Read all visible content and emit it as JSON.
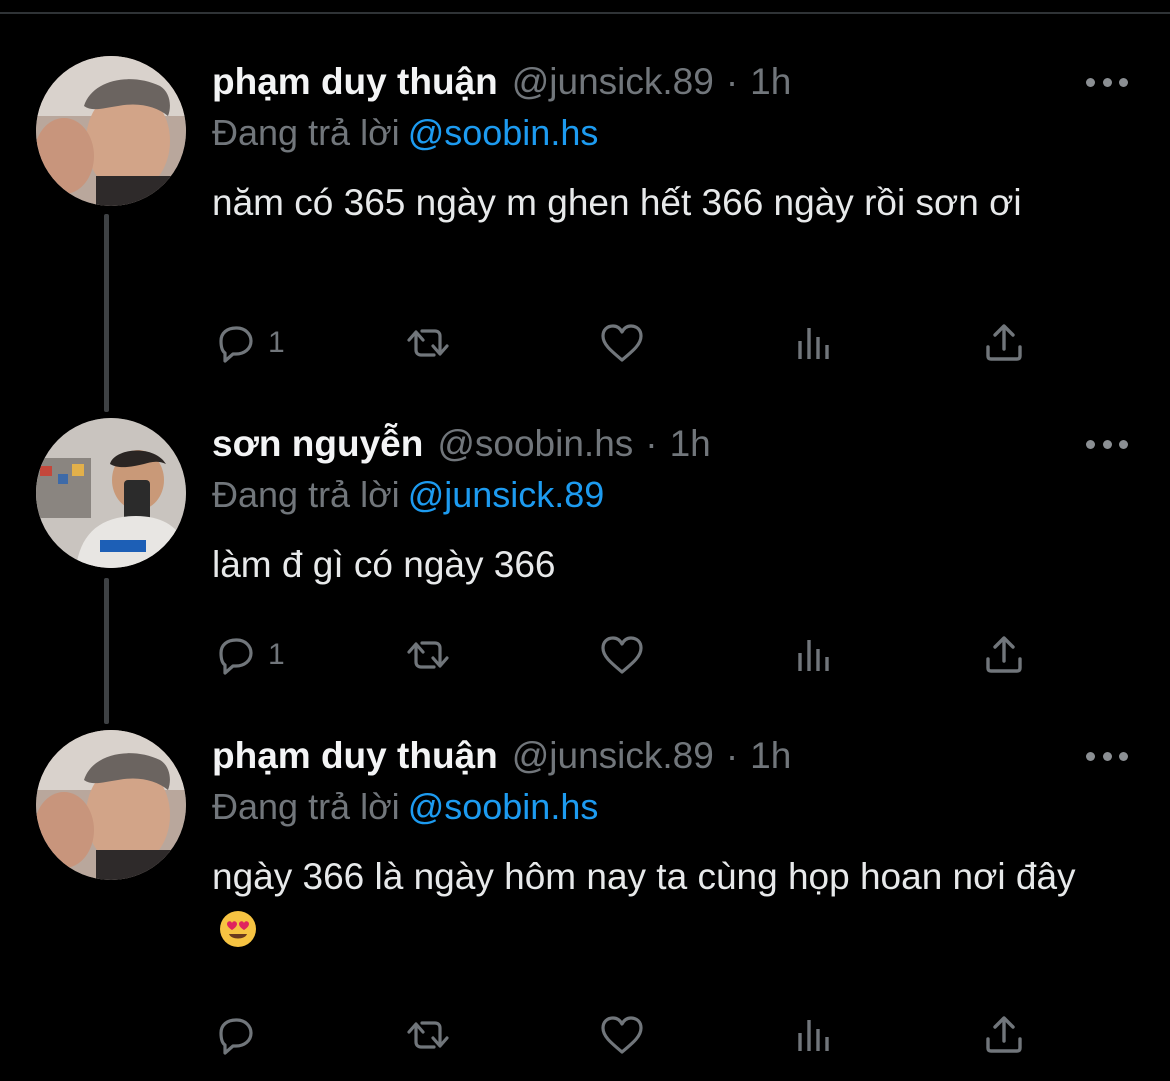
{
  "tweets": [
    {
      "name": "phạm duy thuận",
      "handle": "@junsick.89",
      "separator": "·",
      "time": "1h",
      "reply_prefix": "Đang trả lời",
      "reply_to": "@soobin.hs",
      "text": "năm có 365 ngày m ghen hết 366 ngày rồi sơn ơi",
      "reply_count": "1"
    },
    {
      "name": "sơn nguyễn",
      "handle": "@soobin.hs",
      "separator": "·",
      "time": "1h",
      "reply_prefix": "Đang trả lời",
      "reply_to": "@junsick.89",
      "text": "làm đ gì có ngày 366",
      "reply_count": "1"
    },
    {
      "name": "phạm duy thuận",
      "handle": "@junsick.89",
      "separator": "·",
      "time": "1h",
      "reply_prefix": "Đang trả lời",
      "reply_to": "@soobin.hs",
      "text": "ngày 366 là ngày hôm nay ta cùng họp hoan nơi đây",
      "emoji": "heart-eyes-emoji",
      "reply_count": ""
    }
  ],
  "icons": {
    "reply": "reply-icon",
    "retweet": "retweet-icon",
    "like": "heart-icon",
    "views": "analytics-icon",
    "share": "share-icon",
    "more": "more-icon"
  },
  "colors": {
    "background": "#000000",
    "text": "#e7e9ea",
    "secondary": "#71767b",
    "accent": "#1d9bf0"
  }
}
